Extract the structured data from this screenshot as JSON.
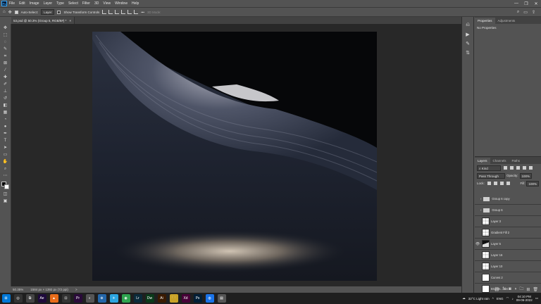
{
  "app": {
    "logo": "Ps"
  },
  "menu": [
    "File",
    "Edit",
    "Image",
    "Layer",
    "Type",
    "Select",
    "Filter",
    "3D",
    "View",
    "Window",
    "Help"
  ],
  "window_controls": {
    "minimize": "—",
    "restore": "❐",
    "close": "✕"
  },
  "options_bar": {
    "auto_select_label": "Auto-Select:",
    "auto_select_target": "Layer",
    "show_transform_label": "Show Transform Controls",
    "mode_3d_label": "3D Mode:",
    "more": "•••"
  },
  "document_tab": {
    "title": "53.psd @ 50.3% (Group 5, RGB/8#) *",
    "close": "×"
  },
  "status_bar": {
    "zoom": "50.35%",
    "doc_size": "1584 px × 1392 px (72 ppi)",
    "arrow": ">"
  },
  "properties_panel": {
    "tabs": [
      "Properties",
      "Adjustments"
    ],
    "message": "No Properties"
  },
  "layers_panel": {
    "tabs": [
      "Layers",
      "Channels",
      "Paths"
    ],
    "filter": "Kind",
    "blend_mode": "Pass Through",
    "opacity_label": "Opacity:",
    "opacity": "100%",
    "lock_label": "Lock:",
    "fill_label": "Fill:",
    "fill": "100%",
    "layers": [
      {
        "name": "Group 6 copy",
        "type": "group",
        "visible": false
      },
      {
        "name": "Group 6",
        "type": "group",
        "visible": false
      },
      {
        "name": "Layer 3",
        "type": "pixel",
        "visible": false
      },
      {
        "name": "Gradient Fill 2",
        "type": "fill",
        "visible": false
      },
      {
        "name": "Layer 5",
        "type": "dark",
        "visible": true
      },
      {
        "name": "Layer 16",
        "type": "pixel",
        "visible": false
      },
      {
        "name": "Layer 10",
        "type": "pixel",
        "visible": false
      },
      {
        "name": "Curves 2",
        "type": "adjustment",
        "visible": false
      },
      {
        "name": "Brightn...rast 3",
        "type": "adjustment",
        "visible": false
      }
    ]
  },
  "taskbar": {
    "apps": [
      "⊞",
      "◎",
      "⧉",
      "Ae",
      "▲",
      "⊡",
      "Pr",
      "◐",
      "⊕",
      "✈",
      "◉",
      "Lr",
      "Dw",
      "Ai",
      "🗀",
      "Xd",
      "Ps",
      "◍",
      "▤"
    ],
    "weather": "32°C  Light rain",
    "lang": "ENG",
    "time": "04:10 PM",
    "date": "09-06-2022"
  },
  "colors": {
    "accent": "#31a8ff",
    "ui_bg": "#535353",
    "canvas_bg": "#282828",
    "taskbar": "#1f1f1f"
  }
}
